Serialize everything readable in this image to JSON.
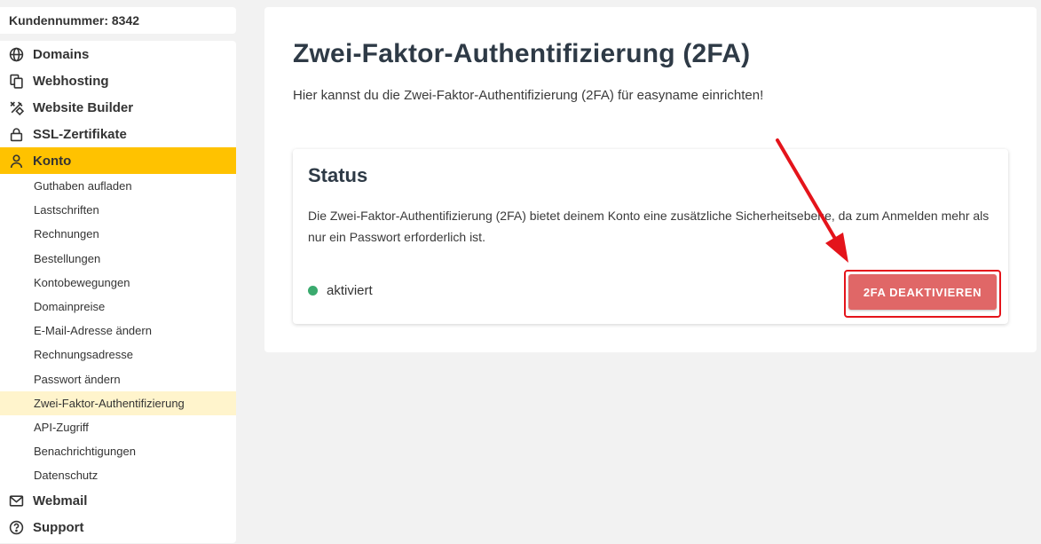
{
  "sidebar": {
    "customer_number": "Kundennummer: 8342",
    "items": [
      {
        "label": "Domains",
        "icon": "globe-icon"
      },
      {
        "label": "Webhosting",
        "icon": "copy-icon"
      },
      {
        "label": "Website Builder",
        "icon": "tools-icon"
      },
      {
        "label": "SSL-Zertifikate",
        "icon": "lock-icon"
      },
      {
        "label": "Konto",
        "icon": "user-icon",
        "active": true
      }
    ],
    "sub_items": [
      "Guthaben aufladen",
      "Lastschriften",
      "Rechnungen",
      "Bestellungen",
      "Kontobewegungen",
      "Domainpreise",
      "E-Mail-Adresse ändern",
      "Rechnungsadresse",
      "Passwort ändern",
      "Zwei-Faktor-Authentifizierung",
      "API-Zugriff",
      "Benachrichtigungen",
      "Datenschutz"
    ],
    "bottom_items": [
      {
        "label": "Webmail",
        "icon": "mail-icon"
      },
      {
        "label": "Support",
        "icon": "help-icon"
      }
    ]
  },
  "main": {
    "title": "Zwei-Faktor-Authentifizierung (2FA)",
    "intro": "Hier kannst du die Zwei-Faktor-Authentifizierung (2FA) für easyname einrichten!",
    "card": {
      "title": "Status",
      "description": "Die Zwei-Faktor-Authentifizierung (2FA) bietet deinem Konto eine zusätzliche Sicherheitsebene, da zum Anmelden mehr als nur ein Passwort erforderlich ist.",
      "status_label": "aktiviert",
      "button_label": "2FA DEAKTIVIEREN"
    }
  },
  "colors": {
    "accent": "#ffc200",
    "active_sub_bg": "#fff4cc",
    "status_green": "#3aaa6e",
    "danger_button": "#e06767",
    "highlight_red": "#e4141b"
  }
}
